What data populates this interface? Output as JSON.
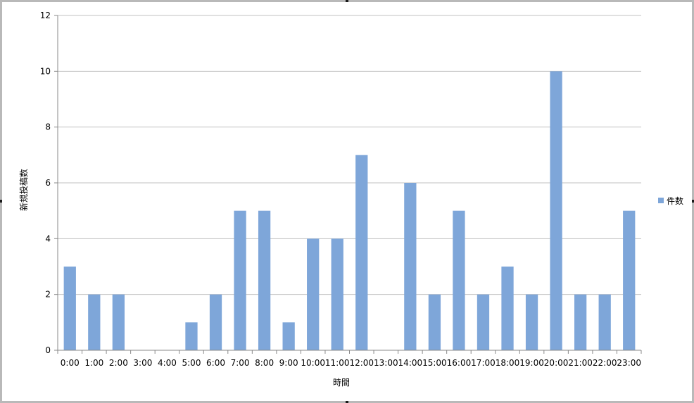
{
  "chart_data": {
    "type": "bar",
    "categories": [
      "0:00",
      "1:00",
      "2:00",
      "3:00",
      "4:00",
      "5:00",
      "6:00",
      "7:00",
      "8:00",
      "9:00",
      "10:00",
      "11:00",
      "12:00",
      "13:00",
      "14:00",
      "15:00",
      "16:00",
      "17:00",
      "18:00",
      "19:00",
      "20:00",
      "21:00",
      "22:00",
      "23:00"
    ],
    "series": [
      {
        "name": "件数",
        "values": [
          3,
          2,
          2,
          0,
          0,
          1,
          2,
          5,
          5,
          1,
          4,
          4,
          7,
          0,
          6,
          2,
          5,
          2,
          3,
          2,
          10,
          2,
          2,
          5
        ],
        "color": "#7ea6d9"
      }
    ],
    "xlabel": "時間",
    "ylabel": "新規投稿数",
    "ylim": [
      0,
      12
    ],
    "yticks": [
      0,
      2,
      4,
      6,
      8,
      10,
      12
    ],
    "grid": true,
    "legend": "right"
  }
}
